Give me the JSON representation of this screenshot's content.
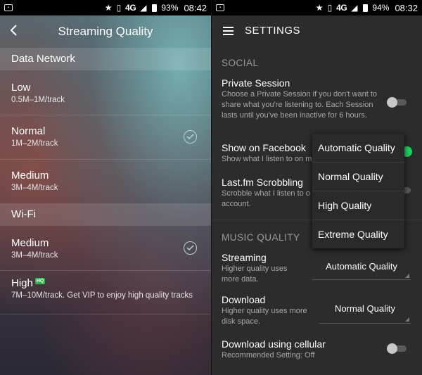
{
  "left": {
    "status": {
      "network": "4G",
      "battery": "93%",
      "time": "08:42"
    },
    "header": {
      "title": "Streaming Quality"
    },
    "data_network": {
      "label": "Data Network",
      "options": [
        {
          "name": "Low",
          "sub": "0.5M–1M/track",
          "selected": false
        },
        {
          "name": "Normal",
          "sub": "1M–2M/track",
          "selected": true
        },
        {
          "name": "Medium",
          "sub": "3M–4M/track",
          "selected": false
        }
      ]
    },
    "wifi": {
      "label": "Wi-Fi",
      "options": [
        {
          "name": "Medium",
          "sub": "3M–4M/track",
          "selected": true
        },
        {
          "name": "High",
          "badge": "HQ",
          "sub": "7M–10M/track. Get VIP to enjoy high quality tracks",
          "selected": false
        }
      ]
    }
  },
  "right": {
    "status": {
      "network": "4G",
      "battery": "94%",
      "time": "08:32"
    },
    "header": {
      "title": "SETTINGS"
    },
    "social": {
      "label": "SOCIAL",
      "private_session": {
        "name": "Private Session",
        "desc": "Choose a Private Session if you don't want to share what you're listening to. Each Session lasts until you've been inactive for 6 hours.",
        "on": false
      },
      "facebook": {
        "name": "Show on Facebook",
        "desc": "Show what I listen to on m",
        "on": true
      },
      "lastfm": {
        "name": "Last.fm Scrobbling",
        "desc": "Scrobble what I listen to o",
        "desc2": "account.",
        "on": false
      }
    },
    "music_quality": {
      "label": "MUSIC QUALITY",
      "streaming": {
        "name": "Streaming",
        "desc": "Higher quality uses more data.",
        "value": "Automatic Quality"
      },
      "download": {
        "name": "Download",
        "desc": "Higher quality uses more disk space.",
        "value": "Normal Quality"
      },
      "cellular": {
        "name": "Download using cellular",
        "desc": "Recommended Setting: Off",
        "on": false
      }
    },
    "dropdown": {
      "options": [
        "Automatic Quality",
        "Normal Quality",
        "High Quality",
        "Extreme Quality"
      ]
    }
  },
  "colors": {
    "accent_green": "#1ed760",
    "check": "#b8d7d0",
    "hq_badge": "#2cb24a"
  }
}
